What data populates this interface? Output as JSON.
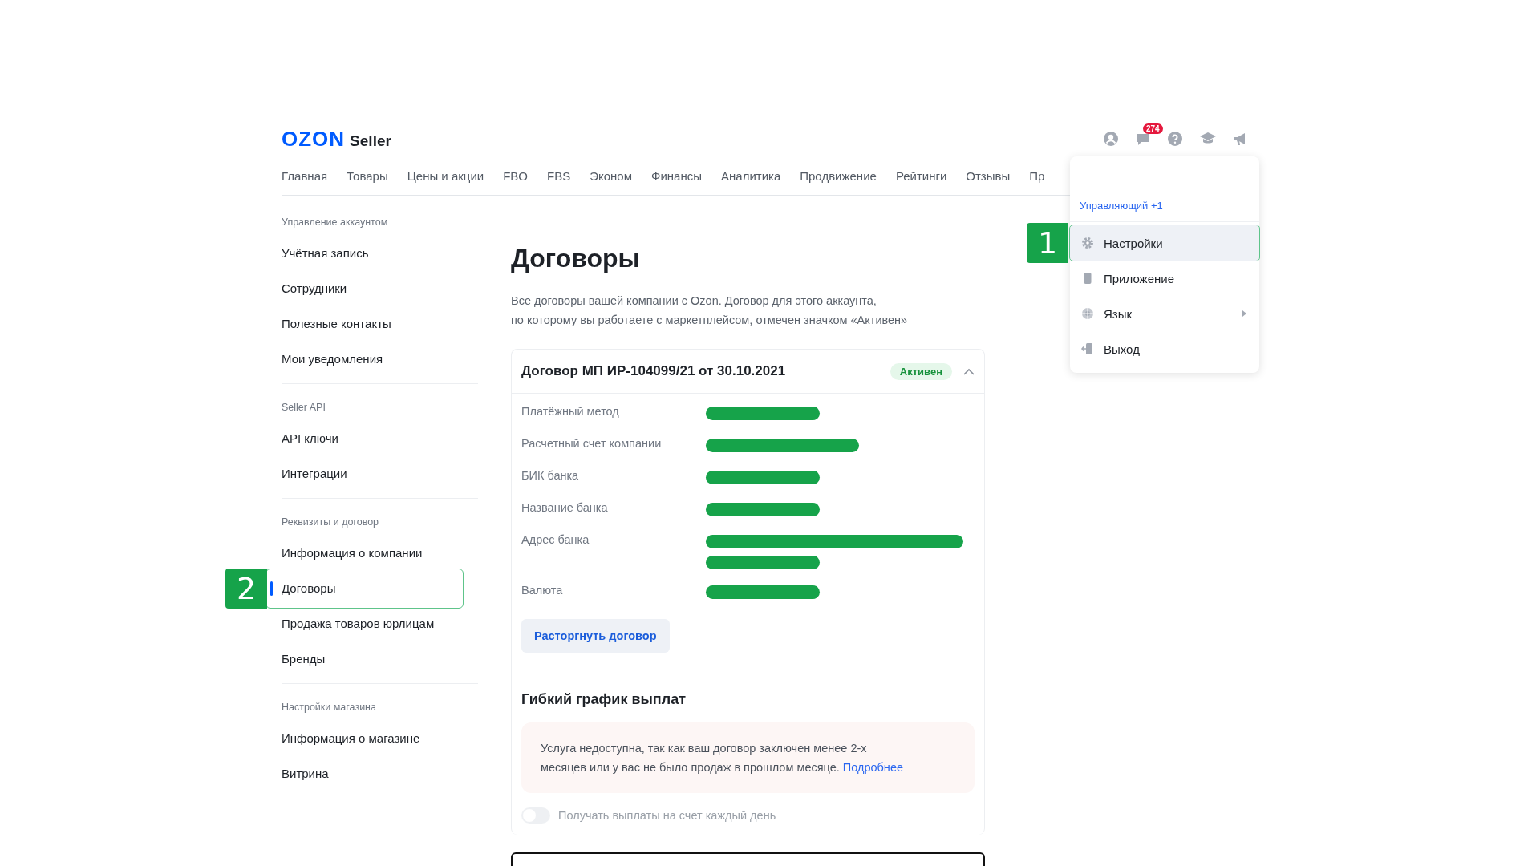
{
  "header": {
    "logo": {
      "brand": "OZON",
      "product": "Seller"
    },
    "icons": [
      {
        "kind": "user"
      },
      {
        "kind": "chat",
        "badge": "274"
      },
      {
        "kind": "help"
      },
      {
        "kind": "cap"
      },
      {
        "kind": "megaphone"
      }
    ]
  },
  "nav": [
    "Главная",
    "Товары",
    "Цены и акции",
    "FBO",
    "FBS",
    "Эконом",
    "Финансы",
    "Аналитика",
    "Продвижение",
    "Рейтинги",
    "Отзывы",
    "Пр"
  ],
  "account_menu": {
    "role": "Управляющий +1",
    "items": [
      {
        "label": "Настройки",
        "kind": "settings",
        "highlighted": true,
        "marker": "1",
        "submenu": false
      },
      {
        "label": "Приложение",
        "kind": "phone",
        "highlighted": false,
        "submenu": false
      },
      {
        "label": "Язык",
        "kind": "globe",
        "highlighted": false,
        "submenu": true
      },
      {
        "label": "Выход",
        "kind": "exit",
        "highlighted": false,
        "submenu": false
      }
    ]
  },
  "sidebar": {
    "sections": [
      {
        "heading": "Управление аккаунтом",
        "items": [
          {
            "label": "Учётная запись",
            "selected": false
          },
          {
            "label": "Сотрудники",
            "selected": false
          },
          {
            "label": "Полезные контакты",
            "selected": false
          },
          {
            "label": "Мои уведомления",
            "selected": false
          }
        ]
      },
      {
        "heading": "Seller API",
        "items": [
          {
            "label": "API ключи",
            "selected": false
          },
          {
            "label": "Интеграции",
            "selected": false
          }
        ]
      },
      {
        "heading": "Реквизиты и договор",
        "items": [
          {
            "label": "Информация о компании",
            "selected": false
          },
          {
            "label": "Договоры",
            "selected": true,
            "marker": "2"
          },
          {
            "label": "Продажа товаров юрлицам",
            "selected": false
          },
          {
            "label": "Бренды",
            "selected": false
          }
        ]
      },
      {
        "heading": "Настройки магазина",
        "items": [
          {
            "label": "Информация о магазине",
            "selected": false
          },
          {
            "label": "Витрина",
            "selected": false
          }
        ]
      }
    ]
  },
  "page": {
    "title": "Договоры",
    "description": [
      "Все договоры вашей компании с Ozon. Договор для этого аккаунта,",
      "по которому вы работаете с маркетплейсом, отмечен значком «Активен»"
    ]
  },
  "contract": {
    "title": "Договор МП ИР-104099/21 от 30.10.2021",
    "status": "Активен",
    "expanded": true,
    "fields": [
      {
        "label": "Платёжный метод",
        "value_bars": [
          {
            "kind": "short"
          }
        ]
      },
      {
        "label": "Расчетный счет компании",
        "value_bars": [
          {
            "kind": "medium"
          }
        ]
      },
      {
        "label": "БИК банка",
        "value_bars": [
          {
            "kind": "short"
          }
        ]
      },
      {
        "label": "Название банка",
        "value_bars": [
          {
            "kind": "short"
          }
        ]
      },
      {
        "label": "Адрес банка",
        "value_bars": [
          {
            "kind": "long"
          },
          {
            "kind": "short"
          }
        ]
      },
      {
        "label": "Валюта",
        "value_bars": [
          {
            "kind": "short"
          }
        ]
      }
    ],
    "terminate_button": "Расторгнуть договор"
  },
  "flex_payouts": {
    "title": "Гибкий график выплат",
    "notice": {
      "text": "Услуга недоступна, так как ваш договор заключен менее 2-х месяцев или у вас не было продаж в прошлом месяце.",
      "link": "Подробнее"
    },
    "toggle": {
      "label": "Получать выплаты на счет каждый день",
      "on": false,
      "disabled": true
    }
  }
}
